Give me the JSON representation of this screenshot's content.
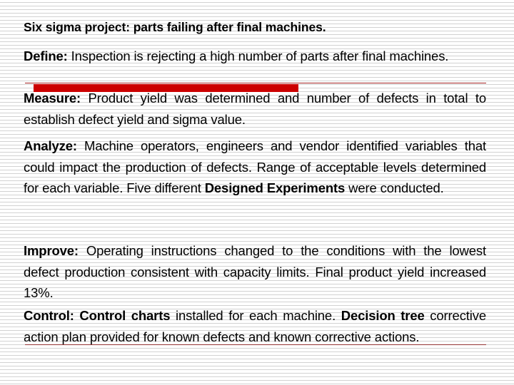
{
  "slide": {
    "title": "Six sigma project: parts failing after final machines.",
    "accent_color": "#CC0000",
    "rule_color": "#933333",
    "background": "#FFFFFF",
    "text_color": "#000000",
    "sections": {
      "define": {
        "label": "Define:",
        "body": " Inspection is rejecting a high number of parts after final machines."
      },
      "measure": {
        "label": "Measure:",
        "body": " Product yield was determined and number of defects in total to establish defect yield and sigma value."
      },
      "analyze": {
        "label": "Analyze:",
        "body_1": " Machine operators, engineers and vendor identified variables that could impact the production of defects. Range of acceptable levels determined for each variable. Five different ",
        "emphasis": "Designed Experiments",
        "body_2": " were conducted."
      },
      "improve": {
        "label": "Improve:",
        "body": " Operating instructions changed to the conditions with the lowest defect production consistent with capacity limits. Final product yield increased 13%."
      },
      "control": {
        "label": "Control:",
        "emphasis_1": " Control charts",
        "body_1": " installed for each machine. ",
        "emphasis_2": "Decision tree",
        "body_2": " corrective action plan provided for known defects and known corrective actions."
      }
    }
  }
}
